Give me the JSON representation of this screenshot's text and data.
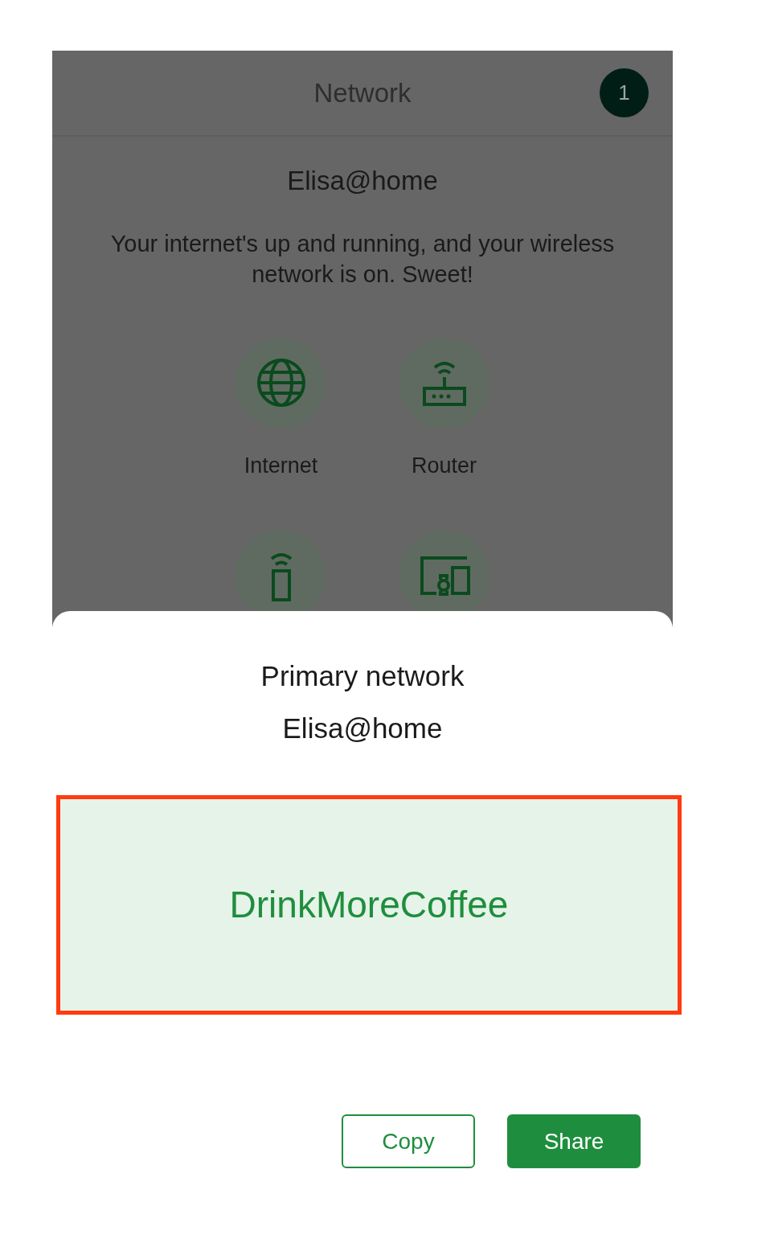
{
  "header": {
    "title": "Network",
    "badge": "1"
  },
  "network_name": "Elisa@home",
  "status_message": "Your internet's up and running, and your wireless network is on. Sweet!",
  "tiles": [
    {
      "kind": "globe",
      "label": "Internet"
    },
    {
      "kind": "router",
      "label": "Router"
    },
    {
      "kind": "point"
    },
    {
      "kind": "devices"
    }
  ],
  "sheet": {
    "title": "Primary network",
    "subtitle": "Elisa@home",
    "password": "DrinkMoreCoffee",
    "highlighted": true,
    "buttons": [
      {
        "kind": "outline",
        "label": "Copy"
      },
      {
        "kind": "filled",
        "label": "Share"
      }
    ]
  }
}
